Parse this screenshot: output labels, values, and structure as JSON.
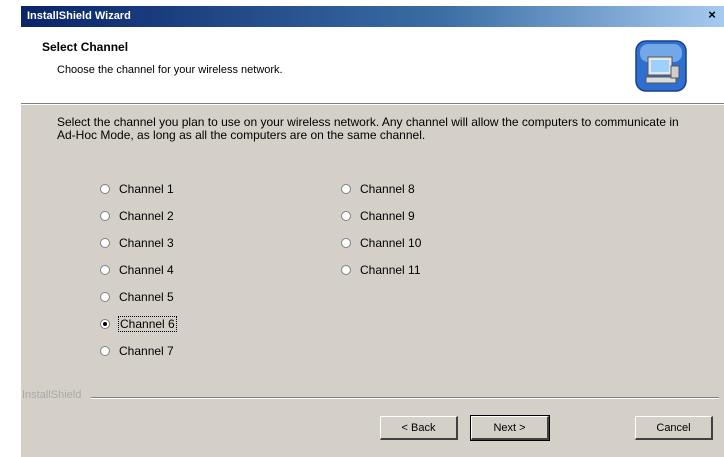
{
  "window": {
    "title": "InstallShield Wizard",
    "close_glyph": "×"
  },
  "header": {
    "title": "Select Channel",
    "subtitle": "Choose the channel for your wireless network."
  },
  "description": "Select the channel you plan to use on your wireless network. Any channel will allow the computers to communicate in Ad-Hoc Mode, as long as all the computers are on the same channel.",
  "channels": {
    "left": [
      "Channel 1",
      "Channel 2",
      "Channel 3",
      "Channel 4",
      "Channel 5",
      "Channel 6",
      "Channel 7"
    ],
    "right": [
      "Channel 8",
      "Channel 9",
      "Channel 10",
      "Channel 11"
    ],
    "selected": "Channel 6"
  },
  "footer": {
    "brand": "InstallShield"
  },
  "buttons": {
    "back": "< Back",
    "next": "Next >",
    "cancel": "Cancel"
  },
  "icons": {
    "header": "network-computer-icon"
  }
}
